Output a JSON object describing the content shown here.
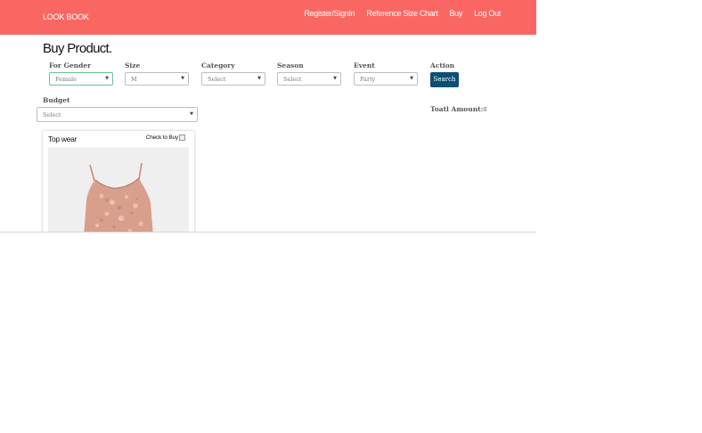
{
  "nav": {
    "brand": "LOOK BOOK",
    "links": [
      "Register/SignIn",
      "Reference Size Chart",
      "Buy",
      "Log Out"
    ]
  },
  "page": {
    "title": "Buy Product."
  },
  "filters": {
    "gender": {
      "label": "For Gender",
      "value": "Female"
    },
    "size": {
      "label": "Size",
      "value": "M"
    },
    "category": {
      "label": "Category",
      "value": "Select"
    },
    "season": {
      "label": "Season",
      "value": "Select"
    },
    "event": {
      "label": "Event",
      "value": "Party"
    },
    "action": {
      "label": "Action",
      "button": "Search"
    },
    "budget": {
      "label": "Budget",
      "value": "Select"
    }
  },
  "summary": {
    "total_label": "Toatl Amount:",
    "total_value": "0"
  },
  "products": [
    {
      "title": "Top wear",
      "check_label": "Check to Buy",
      "image": "pink-sequin-camisole"
    }
  ],
  "colors": {
    "navbar": "#fa6762",
    "button": "#0d4f73"
  }
}
